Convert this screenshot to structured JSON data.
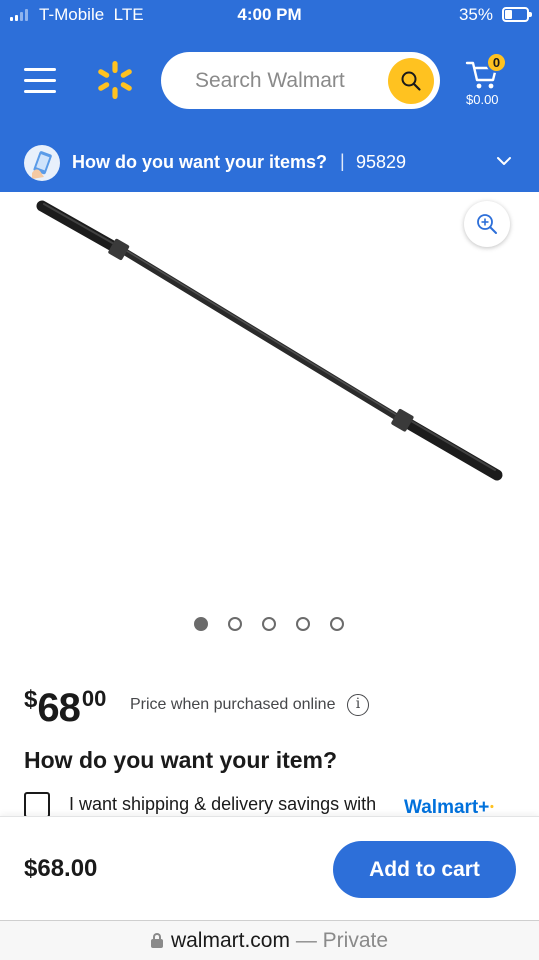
{
  "status_bar": {
    "carrier": "T-Mobile",
    "network": "LTE",
    "time": "4:00 PM",
    "battery_percent": "35%",
    "battery_level": 0.35
  },
  "header": {
    "brand_color": "#2d6fd9",
    "search_placeholder": "Search Walmart",
    "cart_count": "0",
    "cart_total": "$0.00"
  },
  "delivery": {
    "question": "How do you want your items?",
    "separator": "|",
    "zip": "95829"
  },
  "product": {
    "image_icon": "olympic-barbell-image",
    "carousel_count": 5,
    "carousel_active_index": 0,
    "price_currency": "$",
    "price_dollars": "68",
    "price_cents": "00",
    "price_note": "Price when purchased online",
    "info_symbol": "i"
  },
  "fulfillment": {
    "title": "How do you want your item?",
    "shipping_label": "I want shipping & delivery savings with",
    "walmart_plus": "Walmart+",
    "checked": false
  },
  "purchase_bar": {
    "price": "$68.00",
    "add_to_cart_label": "Add to cart"
  },
  "browser": {
    "domain": "walmart.com",
    "mode": "— Private"
  },
  "colors": {
    "accent_blue": "#2d6fd9",
    "walmart_yellow": "#ffc220",
    "walmart_plus_blue": "#0071dc"
  }
}
